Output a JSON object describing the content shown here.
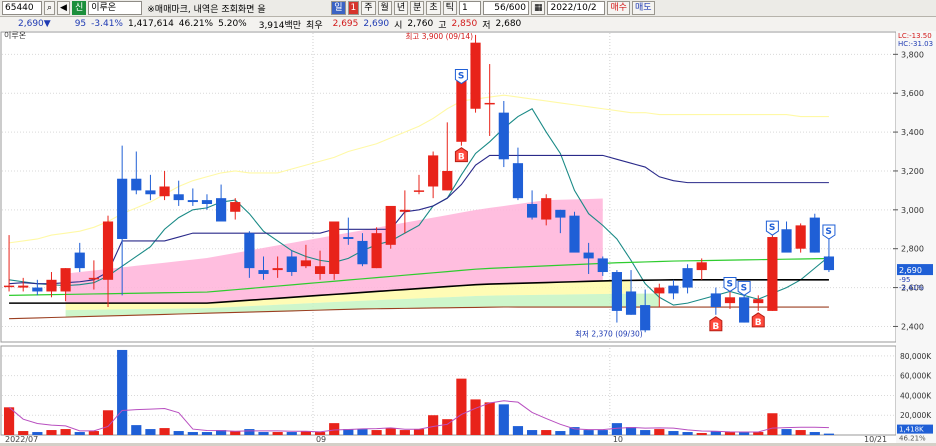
{
  "toolbar": {
    "code": "65440",
    "stock_name": "이루온",
    "credit_tag": "신",
    "market_news": "※매매마크, 내역은 조회화면 을",
    "vol_btn": "일",
    "num_btn": "1",
    "period_week": "주",
    "period_month": "월",
    "period_year": "년",
    "period_min": "분",
    "period_tick": "초",
    "period_tk": "틱",
    "count_value": "1",
    "range_text": "56/600",
    "date_value": "2022/10/2",
    "buy_btn": "매수",
    "sell_btn": "매도"
  },
  "quote": {
    "price": "2,690",
    "arrow": "▼",
    "change": "95",
    "change_rate": "-3.41%",
    "volume": "1,417,614",
    "turnover": "46.21%",
    "per": "5.20%",
    "amount": "3,914백만",
    "best_label": "최우",
    "best_value": "2,695",
    "best_value2": "2,690",
    "open_label": "시",
    "open_value": "2,760",
    "high_label": "고",
    "high_value": "2,850",
    "low_label": "저",
    "low_value": "2,680"
  },
  "chart_data": {
    "type": "candlestick",
    "title": "이루온",
    "x_date_labels": [
      "2022/07",
      "09",
      "10",
      "10/21"
    ],
    "price_axis": {
      "ylim": [
        2320,
        3920
      ],
      "ticks": [
        "3,800",
        "3,600",
        "3,400",
        "3,200",
        "3,000",
        "2,800",
        "2,600",
        "2,400"
      ]
    },
    "price_tag": "2,690",
    "price_sub_tags": [
      "-95",
      "-3.41%"
    ],
    "corner_tags": [
      "LC:-13.50",
      "HC:-31.03"
    ],
    "candles": [
      {
        "o": 2610,
        "h": 2870,
        "l": 2580,
        "c": 2610
      },
      {
        "o": 2600,
        "h": 2650,
        "l": 2580,
        "c": 2610
      },
      {
        "o": 2600,
        "h": 2640,
        "l": 2560,
        "c": 2580
      },
      {
        "o": 2580,
        "h": 2680,
        "l": 2550,
        "c": 2640
      },
      {
        "o": 2580,
        "h": 2700,
        "l": 2530,
        "c": 2700
      },
      {
        "o": 2780,
        "h": 2830,
        "l": 2680,
        "c": 2700
      },
      {
        "o": 2650,
        "h": 2740,
        "l": 2590,
        "c": 2650
      },
      {
        "o": 2640,
        "h": 2970,
        "l": 2500,
        "c": 2940
      },
      {
        "o": 3160,
        "h": 3330,
        "l": 2560,
        "c": 2850
      },
      {
        "o": 3160,
        "h": 3300,
        "l": 3080,
        "c": 3100
      },
      {
        "o": 3100,
        "h": 3180,
        "l": 3050,
        "c": 3080
      },
      {
        "o": 3070,
        "h": 3200,
        "l": 3050,
        "c": 3120
      },
      {
        "o": 3080,
        "h": 3150,
        "l": 3020,
        "c": 3050
      },
      {
        "o": 3050,
        "h": 3110,
        "l": 3020,
        "c": 3040
      },
      {
        "o": 3050,
        "h": 3080,
        "l": 3000,
        "c": 3030
      },
      {
        "o": 3060,
        "h": 3130,
        "l": 2950,
        "c": 2940
      },
      {
        "o": 2990,
        "h": 3060,
        "l": 2950,
        "c": 3040
      },
      {
        "o": 2880,
        "h": 2890,
        "l": 2650,
        "c": 2700
      },
      {
        "o": 2690,
        "h": 2760,
        "l": 2640,
        "c": 2670
      },
      {
        "o": 2690,
        "h": 2760,
        "l": 2650,
        "c": 2700
      },
      {
        "o": 2760,
        "h": 2790,
        "l": 2660,
        "c": 2680
      },
      {
        "o": 2710,
        "h": 2820,
        "l": 2700,
        "c": 2740
      },
      {
        "o": 2670,
        "h": 2790,
        "l": 2640,
        "c": 2710
      },
      {
        "o": 2670,
        "h": 2760,
        "l": 2640,
        "c": 2940
      },
      {
        "o": 2860,
        "h": 2960,
        "l": 2820,
        "c": 2850
      },
      {
        "o": 2840,
        "h": 2880,
        "l": 2710,
        "c": 2720
      },
      {
        "o": 2700,
        "h": 2910,
        "l": 2700,
        "c": 2880
      },
      {
        "o": 2820,
        "h": 3000,
        "l": 2800,
        "c": 3020
      },
      {
        "o": 2990,
        "h": 3100,
        "l": 2880,
        "c": 3000
      },
      {
        "o": 3100,
        "h": 3180,
        "l": 3080,
        "c": 3100
      },
      {
        "o": 3120,
        "h": 3300,
        "l": 3060,
        "c": 3280
      },
      {
        "o": 3100,
        "h": 3450,
        "l": 3100,
        "c": 3200
      },
      {
        "o": 3350,
        "h": 3650,
        "l": 3330,
        "c": 3680
      },
      {
        "o": 3520,
        "h": 3900,
        "l": 3500,
        "c": 3860
      },
      {
        "o": 3550,
        "h": 3750,
        "l": 3380,
        "c": 3550
      },
      {
        "o": 3500,
        "h": 3560,
        "l": 3220,
        "c": 3260
      },
      {
        "o": 3240,
        "h": 3320,
        "l": 3050,
        "c": 3060
      },
      {
        "o": 3030,
        "h": 3100,
        "l": 2950,
        "c": 2960
      },
      {
        "o": 2950,
        "h": 3080,
        "l": 2920,
        "c": 3060
      },
      {
        "o": 3000,
        "h": 3000,
        "l": 2880,
        "c": 2960
      },
      {
        "o": 2970,
        "h": 2990,
        "l": 2820,
        "c": 2780
      },
      {
        "o": 2780,
        "h": 2830,
        "l": 2670,
        "c": 2750
      },
      {
        "o": 2750,
        "h": 2760,
        "l": 2660,
        "c": 2680
      },
      {
        "o": 2680,
        "h": 2690,
        "l": 2420,
        "c": 2480
      },
      {
        "o": 2580,
        "h": 2690,
        "l": 2460,
        "c": 2460
      },
      {
        "o": 2510,
        "h": 2590,
        "l": 2370,
        "c": 2380
      },
      {
        "o": 2570,
        "h": 2620,
        "l": 2500,
        "c": 2600
      },
      {
        "o": 2610,
        "h": 2640,
        "l": 2540,
        "c": 2570
      },
      {
        "o": 2700,
        "h": 2720,
        "l": 2570,
        "c": 2600
      },
      {
        "o": 2690,
        "h": 2750,
        "l": 2640,
        "c": 2730
      },
      {
        "o": 2570,
        "h": 2600,
        "l": 2460,
        "c": 2500
      },
      {
        "o": 2520,
        "h": 2580,
        "l": 2490,
        "c": 2550
      },
      {
        "o": 2550,
        "h": 2560,
        "l": 2420,
        "c": 2420
      },
      {
        "o": 2520,
        "h": 2560,
        "l": 2480,
        "c": 2540
      },
      {
        "o": 2480,
        "h": 2870,
        "l": 2480,
        "c": 2860
      },
      {
        "o": 2900,
        "h": 2940,
        "l": 2800,
        "c": 2780
      },
      {
        "o": 2800,
        "h": 2930,
        "l": 2780,
        "c": 2920
      },
      {
        "o": 2960,
        "h": 2980,
        "l": 2780,
        "c": 2780
      },
      {
        "o": 2760,
        "h": 2850,
        "l": 2680,
        "c": 2690
      }
    ],
    "moving_averages": [
      {
        "name": "MA5",
        "color": "#1a8a86",
        "values": [
          2640,
          2630,
          2620,
          2615,
          2610,
          2615,
          2625,
          2660,
          2710,
          2760,
          2810,
          2900,
          2960,
          3000,
          3010,
          3040,
          3050,
          2980,
          2890,
          2840,
          2790,
          2760,
          2740,
          2730,
          2750,
          2790,
          2820,
          2840,
          2880,
          2920,
          3020,
          3060,
          3180,
          3290,
          3350,
          3420,
          3480,
          3520,
          3400,
          3290,
          3100,
          2980,
          2920,
          2850,
          2740,
          2620,
          2550,
          2510,
          2520,
          2540,
          2560,
          2580,
          2560,
          2540,
          2570,
          2600,
          2640,
          2700,
          2760
        ]
      },
      {
        "name": "MA10",
        "color": "#2a2a8a",
        "values": [
          2620,
          2625,
          2620,
          2620,
          2625,
          2630,
          2640,
          2680,
          2840,
          2840,
          2840,
          2840,
          2860,
          2880,
          2880,
          2880,
          2880,
          2880,
          2880,
          2880,
          2880,
          2880,
          2880,
          2900,
          2900,
          2900,
          2900,
          2900,
          2990,
          3000,
          3020,
          3060,
          3130,
          3230,
          3280,
          3280,
          3280,
          3280,
          3280,
          3280,
          3280,
          3280,
          3280,
          3260,
          3240,
          3220,
          3170,
          3150,
          3140,
          3140,
          3140,
          3140,
          3140,
          3140,
          3140,
          3140,
          3140,
          3140,
          3140
        ]
      },
      {
        "name": "MA20",
        "color": "#fff9a6",
        "values": [
          2830,
          2840,
          2850,
          2870,
          2880,
          2890,
          2910,
          2940,
          2980,
          3010,
          3040,
          3080,
          3120,
          3150,
          3170,
          3190,
          3200,
          3190,
          3190,
          3190,
          3210,
          3230,
          3250,
          3270,
          3300,
          3320,
          3340,
          3370,
          3400,
          3430,
          3470,
          3520,
          3560,
          3570,
          3580,
          3590,
          3580,
          3570,
          3560,
          3550,
          3540,
          3530,
          3520,
          3510,
          3500,
          3500,
          3490,
          3490,
          3490,
          3490,
          3490,
          3490,
          3490,
          3490,
          3490,
          3490,
          3480,
          3480,
          3480
        ]
      },
      {
        "name": "MA60",
        "color": "#000000",
        "values": [
          2520,
          2520,
          2520,
          2520,
          2520,
          2520,
          2520,
          2520,
          2520,
          2520,
          2520,
          2520,
          2520,
          2520,
          2520,
          2525,
          2530,
          2535,
          2540,
          2545,
          2550,
          2555,
          2560,
          2565,
          2570,
          2575,
          2580,
          2585,
          2590,
          2595,
          2600,
          2605,
          2610,
          2615,
          2618,
          2620,
          2622,
          2624,
          2626,
          2628,
          2630,
          2632,
          2634,
          2636,
          2637,
          2638,
          2639,
          2640,
          2640,
          2640,
          2640,
          2640,
          2640,
          2640,
          2640,
          2640,
          2640,
          2640,
          2640
        ]
      },
      {
        "name": "MA120",
        "color": "#9b3f21",
        "values": [
          2440,
          2442,
          2444,
          2446,
          2448,
          2450,
          2452,
          2454,
          2456,
          2458,
          2460,
          2462,
          2464,
          2466,
          2468,
          2470,
          2472,
          2474,
          2476,
          2478,
          2480,
          2482,
          2484,
          2486,
          2488,
          2490,
          2491,
          2492,
          2493,
          2494,
          2495,
          2496,
          2497,
          2498,
          2499,
          2500,
          2500,
          2500,
          2500,
          2500,
          2500,
          2500,
          2500,
          2500,
          2500,
          2500,
          2500,
          2500,
          2500,
          2500,
          2500,
          2500,
          2500,
          2500,
          2500,
          2500,
          2500,
          2500,
          2500
        ]
      }
    ],
    "volume_axis": {
      "ylim": [
        0,
        90000
      ],
      "ticks": [
        "80,000K",
        "60,000K",
        "40,000K",
        "20,000K"
      ]
    },
    "volume": [
      28000,
      4000,
      3000,
      5000,
      6000,
      3000,
      4000,
      25000,
      86000,
      10000,
      6000,
      7000,
      4000,
      3000,
      3000,
      5000,
      4000,
      6000,
      3000,
      3000,
      3000,
      4000,
      3000,
      12000,
      6000,
      6000,
      5000,
      7000,
      5000,
      6000,
      20000,
      16000,
      57000,
      36000,
      33000,
      31000,
      9000,
      5000,
      5000,
      4000,
      8000,
      5000,
      5000,
      12000,
      8000,
      5000,
      6000,
      4000,
      3000,
      2000,
      4000,
      3000,
      3000,
      3000,
      22000,
      6000,
      5000,
      3000,
      1400
    ],
    "volume_tags": [
      "1,418K",
      "46.21%"
    ],
    "annotations": [
      {
        "text": "최고 3,900 (09/14)",
        "kind": "high"
      },
      {
        "text": "최저 2,370 (09/30)",
        "kind": "low"
      }
    ],
    "trade_marks": [
      {
        "idx": 32,
        "type": "S"
      },
      {
        "idx": 32,
        "type": "B"
      },
      {
        "idx": 50,
        "type": "B"
      },
      {
        "idx": 51,
        "type": "S"
      },
      {
        "idx": 52,
        "type": "S"
      },
      {
        "idx": 53,
        "type": "B"
      },
      {
        "idx": 54,
        "type": "S"
      },
      {
        "idx": 58,
        "type": "S"
      }
    ]
  }
}
